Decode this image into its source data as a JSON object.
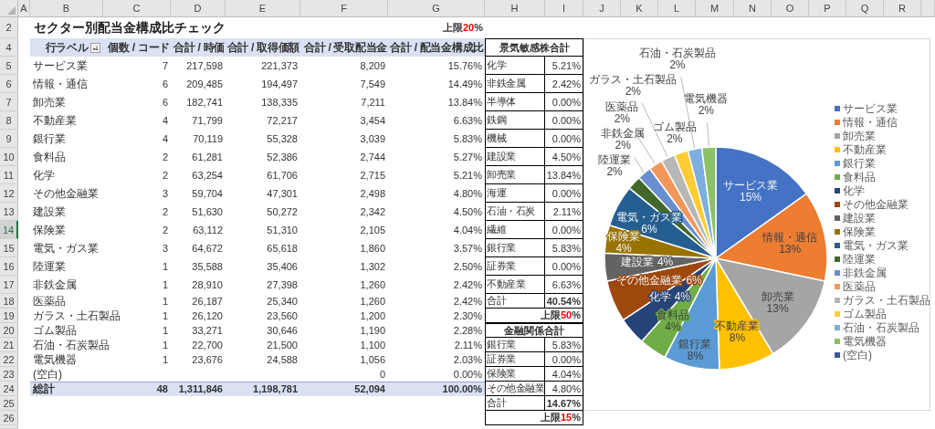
{
  "column_headers": [
    "A",
    "B",
    "C",
    "D",
    "E",
    "F",
    "G",
    "H",
    "I",
    "J",
    "K",
    "L",
    "M",
    "N",
    "O",
    "P",
    "Q",
    "R"
  ],
  "row_numbers": [
    {
      "label": "2",
      "selected": false
    },
    {
      "label": "4",
      "selected": false
    },
    {
      "label": "5",
      "selected": false
    },
    {
      "label": "6",
      "selected": false
    },
    {
      "label": "7",
      "selected": false
    },
    {
      "label": "8",
      "selected": false
    },
    {
      "label": "9",
      "selected": false
    },
    {
      "label": "10",
      "selected": false
    },
    {
      "label": "11",
      "selected": false
    },
    {
      "label": "12",
      "selected": false
    },
    {
      "label": "13",
      "selected": false
    },
    {
      "label": "14",
      "selected": true
    },
    {
      "label": "15",
      "selected": false
    },
    {
      "label": "16",
      "selected": false
    },
    {
      "label": "17",
      "selected": false
    },
    {
      "label": "18",
      "selected": false
    },
    {
      "label": "19",
      "selected": false
    },
    {
      "label": "20",
      "selected": false
    },
    {
      "label": "21",
      "selected": false
    },
    {
      "label": "22",
      "selected": false
    },
    {
      "label": "23",
      "selected": false
    },
    {
      "label": "24",
      "selected": false
    },
    {
      "label": "25",
      "selected": false
    },
    {
      "label": "26",
      "selected": false
    }
  ],
  "title": "セクター別配当金構成比チェック",
  "limit": {
    "label": "上限",
    "value": "20",
    "unit": "%"
  },
  "pivot": {
    "columns": [
      "行ラベル",
      "個数 / コード",
      "合計 / 時価",
      "合計 / 取得価額",
      "合計 / 受取配当金",
      "合計 / 配当金構成比"
    ],
    "rows": [
      {
        "label": "サービス業",
        "count": "7",
        "market_value": "217,598",
        "cost": "221,373",
        "dividend": "8,209",
        "ratio": "15.76%"
      },
      {
        "label": "情報・通信",
        "count": "6",
        "market_value": "209,485",
        "cost": "194,497",
        "dividend": "7,549",
        "ratio": "14.49%"
      },
      {
        "label": "卸売業",
        "count": "6",
        "market_value": "182,741",
        "cost": "138,335",
        "dividend": "7,211",
        "ratio": "13.84%"
      },
      {
        "label": "不動産業",
        "count": "4",
        "market_value": "71,799",
        "cost": "72,217",
        "dividend": "3,454",
        "ratio": "6.63%"
      },
      {
        "label": "銀行業",
        "count": "4",
        "market_value": "70,119",
        "cost": "55,328",
        "dividend": "3,039",
        "ratio": "5.83%"
      },
      {
        "label": "食料品",
        "count": "2",
        "market_value": "61,281",
        "cost": "52,386",
        "dividend": "2,744",
        "ratio": "5.27%"
      },
      {
        "label": "化学",
        "count": "2",
        "market_value": "63,254",
        "cost": "61,706",
        "dividend": "2,715",
        "ratio": "5.21%"
      },
      {
        "label": "その他金融業",
        "count": "3",
        "market_value": "59,704",
        "cost": "47,301",
        "dividend": "2,498",
        "ratio": "4.80%"
      },
      {
        "label": "建設業",
        "count": "2",
        "market_value": "51,630",
        "cost": "50,272",
        "dividend": "2,342",
        "ratio": "4.50%"
      },
      {
        "label": "保険業",
        "count": "2",
        "market_value": "63,112",
        "cost": "51,310",
        "dividend": "2,105",
        "ratio": "4.04%"
      },
      {
        "label": "電気・ガス業",
        "count": "3",
        "market_value": "64,672",
        "cost": "65,618",
        "dividend": "1,860",
        "ratio": "3.57%"
      },
      {
        "label": "陸運業",
        "count": "1",
        "market_value": "35,588",
        "cost": "35,406",
        "dividend": "1,302",
        "ratio": "2.50%"
      },
      {
        "label": "非鉄金属",
        "count": "1",
        "market_value": "28,910",
        "cost": "27,398",
        "dividend": "1,260",
        "ratio": "2.42%"
      },
      {
        "label": "医薬品",
        "count": "1",
        "market_value": "26,187",
        "cost": "25,340",
        "dividend": "1,260",
        "ratio": "2.42%"
      },
      {
        "label": "ガラス・土石製品",
        "count": "1",
        "market_value": "26,120",
        "cost": "23,560",
        "dividend": "1,200",
        "ratio": "2.30%"
      },
      {
        "label": "ゴム製品",
        "count": "1",
        "market_value": "33,271",
        "cost": "30,646",
        "dividend": "1,190",
        "ratio": "2.28%"
      },
      {
        "label": "石油・石炭製品",
        "count": "1",
        "market_value": "22,700",
        "cost": "21,500",
        "dividend": "1,100",
        "ratio": "2.11%"
      },
      {
        "label": "電気機器",
        "count": "1",
        "market_value": "23,676",
        "cost": "24,588",
        "dividend": "1,056",
        "ratio": "2.03%"
      },
      {
        "label": "(空白)",
        "dividend": "0",
        "ratio": "0.00%"
      }
    ],
    "total": {
      "label": "総計",
      "count": "48",
      "market_value": "1,311,846",
      "cost": "1,198,781",
      "dividend": "52,094",
      "ratio": "100.00%"
    }
  },
  "summary_tables": [
    {
      "title": "景気敏感株合計",
      "rows": [
        {
          "label": "化学",
          "value": "5.21%"
        },
        {
          "label": "非鉄金属",
          "value": "2.42%"
        },
        {
          "label": "半導体",
          "value": "0.00%"
        },
        {
          "label": "鉄鋼",
          "value": "0.00%"
        },
        {
          "label": "機械",
          "value": "0.00%"
        },
        {
          "label": "建設業",
          "value": "4.50%"
        },
        {
          "label": "卸売業",
          "value": "13.84%"
        },
        {
          "label": "海運",
          "value": "0.00%"
        },
        {
          "label": "石油・石炭",
          "value": "2.11%"
        },
        {
          "label": "繊維",
          "value": "0.00%"
        },
        {
          "label": "銀行業",
          "value": "5.83%"
        },
        {
          "label": "証券業",
          "value": "0.00%"
        },
        {
          "label": "不動産業",
          "value": "6.63%"
        }
      ],
      "total": {
        "label": "合計",
        "value": "40.54%"
      },
      "limit": {
        "label": "上限",
        "value": "50",
        "unit": "%"
      }
    },
    {
      "title": "金融関係合計",
      "rows": [
        {
          "label": "銀行業",
          "value": "5.83%"
        },
        {
          "label": "証券業",
          "value": "0.00%"
        },
        {
          "label": "保険業",
          "value": "4.04%"
        },
        {
          "label": "その他金融業",
          "value": "4.80%"
        }
      ],
      "total": {
        "label": "合計",
        "value": "14.67%"
      },
      "limit": {
        "label": "上限",
        "value": "15",
        "unit": "%"
      }
    }
  ],
  "chart": {
    "chart_data": {
      "type": "pie",
      "categories": [
        "サービス業",
        "情報・通信",
        "卸売業",
        "不動産業",
        "銀行業",
        "食料品",
        "化学",
        "その他金融業",
        "建設業",
        "保険業",
        "電気・ガス業",
        "陸運業",
        "非鉄金属",
        "医薬品",
        "ガラス・土石製品",
        "ゴム製品",
        "石油・石炭製品",
        "電気機器",
        "(空白)"
      ],
      "values": [
        15,
        13,
        13,
        8,
        8,
        4,
        4,
        6,
        4,
        4,
        6,
        2,
        2,
        2,
        2,
        2,
        2,
        2,
        null
      ],
      "value_labels": [
        "15%",
        "13%",
        "13%",
        "8%",
        "8%",
        "4%",
        "4%",
        "6%",
        "4%",
        "4%",
        "6%",
        "2%",
        "2%",
        "2%",
        "2%",
        "2%",
        "2%",
        "2%",
        null
      ],
      "colors": [
        "#4472c4",
        "#ed7d31",
        "#a5a5a5",
        "#ffc000",
        "#5b9bd5",
        "#70ad47",
        "#264478",
        "#9e480e",
        "#636363",
        "#997300",
        "#255e91",
        "#43682b",
        "#698ed0",
        "#f1975a",
        "#b7b7b7",
        "#ffcd33",
        "#7cafdd",
        "#8cc168",
        "#335aa1"
      ],
      "data_labels": true,
      "legend": "right"
    }
  }
}
